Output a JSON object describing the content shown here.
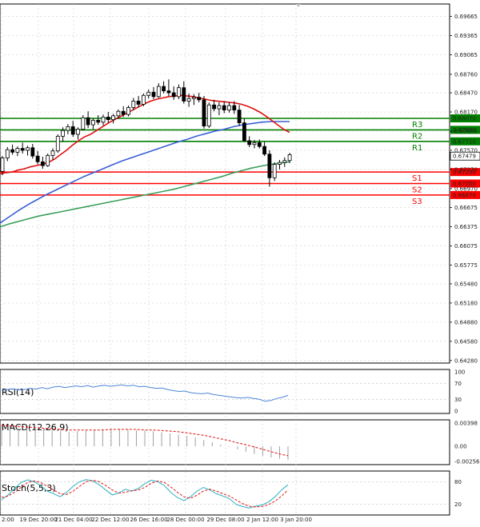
{
  "chart_data": {
    "type": "candlestick",
    "price_axis": {
      "range": [
        0.6424,
        0.6986
      ],
      "ticks": [
        "0.69665",
        "0.69365",
        "0.69065",
        "0.68760",
        "0.68470",
        "0.68170",
        "0.67870",
        "0.67570",
        "0.67270",
        "0.66970",
        "0.66675",
        "0.66375",
        "0.66075",
        "0.65775",
        "0.65480",
        "0.65180",
        "0.64880",
        "0.64580",
        "0.64280"
      ]
    },
    "time_axis": {
      "labels": [
        "2:00",
        "19 Dec 20:00",
        "21 Dec 04:00",
        "22 Dec 12:00",
        "26 Dec 16:00",
        "28 Dec 00:00",
        "29 Dec 08:00",
        "2 Jan 12:00",
        "3 Jan 20:00"
      ]
    },
    "last_price": "0.67479",
    "levels": [
      {
        "name": "R3",
        "value": 0.6807,
        "label": "0.68070",
        "color": "#008000"
      },
      {
        "name": "R2",
        "value": 0.6789,
        "label": "0.67890",
        "color": "#008000"
      },
      {
        "name": "R1",
        "value": 0.6771,
        "label": "0.67710",
        "color": "#008000"
      },
      {
        "name": "S1",
        "value": 0.6723,
        "label": "0.67230",
        "color": "#ff0000"
      },
      {
        "name": "S2",
        "value": 0.6705,
        "label": "0.67050",
        "color": "#ff0000"
      },
      {
        "name": "S3",
        "value": 0.6687,
        "label": "0.66870",
        "color": "#ff0000"
      }
    ],
    "candles": [
      [
        0.6724,
        0.6748,
        0.6718,
        0.6745
      ],
      [
        0.6745,
        0.6762,
        0.674,
        0.6758
      ],
      [
        0.6758,
        0.6766,
        0.675,
        0.6754
      ],
      [
        0.6754,
        0.6763,
        0.6748,
        0.676
      ],
      [
        0.676,
        0.6769,
        0.6752,
        0.6757
      ],
      [
        0.6757,
        0.6764,
        0.6749,
        0.6761
      ],
      [
        0.6761,
        0.6767,
        0.6744,
        0.6748
      ],
      [
        0.6748,
        0.6756,
        0.6735,
        0.6739
      ],
      [
        0.6739,
        0.6747,
        0.6728,
        0.6733
      ],
      [
        0.6733,
        0.6752,
        0.6731,
        0.6749
      ],
      [
        0.6749,
        0.676,
        0.6742,
        0.6756
      ],
      [
        0.6756,
        0.6782,
        0.6753,
        0.6779
      ],
      [
        0.6779,
        0.6793,
        0.677,
        0.6788
      ],
      [
        0.6788,
        0.6798,
        0.6782,
        0.6794
      ],
      [
        0.6794,
        0.6803,
        0.6778,
        0.6782
      ],
      [
        0.6782,
        0.6793,
        0.6774,
        0.679
      ],
      [
        0.679,
        0.6812,
        0.6788,
        0.6808
      ],
      [
        0.6808,
        0.6818,
        0.6792,
        0.6797
      ],
      [
        0.6797,
        0.6807,
        0.679,
        0.6804
      ],
      [
        0.6804,
        0.6812,
        0.6797,
        0.6801
      ],
      [
        0.6801,
        0.6813,
        0.6796,
        0.6809
      ],
      [
        0.6809,
        0.6817,
        0.68,
        0.6805
      ],
      [
        0.6805,
        0.6814,
        0.6799,
        0.6811
      ],
      [
        0.6811,
        0.6821,
        0.6806,
        0.6818
      ],
      [
        0.6818,
        0.6826,
        0.6809,
        0.6813
      ],
      [
        0.6813,
        0.6827,
        0.681,
        0.6824
      ],
      [
        0.6824,
        0.6839,
        0.682,
        0.6834
      ],
      [
        0.6834,
        0.6842,
        0.6824,
        0.6829
      ],
      [
        0.6829,
        0.6846,
        0.6826,
        0.6843
      ],
      [
        0.6843,
        0.6852,
        0.6838,
        0.6848
      ],
      [
        0.6848,
        0.6856,
        0.6837,
        0.6841
      ],
      [
        0.6841,
        0.6862,
        0.6839,
        0.6857
      ],
      [
        0.6857,
        0.6865,
        0.6846,
        0.685
      ],
      [
        0.685,
        0.6868,
        0.6842,
        0.6847
      ],
      [
        0.6847,
        0.6857,
        0.6836,
        0.6841
      ],
      [
        0.6841,
        0.686,
        0.6837,
        0.6855
      ],
      [
        0.6855,
        0.6865,
        0.683,
        0.6834
      ],
      [
        0.6834,
        0.6846,
        0.6825,
        0.6838
      ],
      [
        0.6838,
        0.6845,
        0.6828,
        0.684
      ],
      [
        0.684,
        0.6847,
        0.6832,
        0.6836
      ],
      [
        0.6836,
        0.6842,
        0.6791,
        0.6795
      ],
      [
        0.6795,
        0.6832,
        0.6792,
        0.6828
      ],
      [
        0.6828,
        0.6836,
        0.6818,
        0.6822
      ],
      [
        0.6822,
        0.6832,
        0.6812,
        0.6827
      ],
      [
        0.6827,
        0.6834,
        0.6815,
        0.682
      ],
      [
        0.682,
        0.6832,
        0.6816,
        0.6827
      ],
      [
        0.6827,
        0.6834,
        0.6814,
        0.682
      ],
      [
        0.682,
        0.6828,
        0.6795,
        0.68
      ],
      [
        0.68,
        0.6807,
        0.677,
        0.6772
      ],
      [
        0.6772,
        0.6779,
        0.6762,
        0.6766
      ],
      [
        0.6766,
        0.6773,
        0.676,
        0.6769
      ],
      [
        0.6769,
        0.6774,
        0.676,
        0.6763
      ],
      [
        0.6763,
        0.677,
        0.6748,
        0.6751
      ],
      [
        0.6751,
        0.6757,
        0.67,
        0.6714
      ],
      [
        0.6714,
        0.6738,
        0.6709,
        0.6735
      ],
      [
        0.6735,
        0.6742,
        0.6727,
        0.6738
      ],
      [
        0.6738,
        0.6746,
        0.6731,
        0.6741
      ],
      [
        0.6741,
        0.6753,
        0.6737,
        0.675
      ]
    ],
    "ma_red": [
      0.672,
      0.6722,
      0.6723,
      0.6726,
      0.6728,
      0.6731,
      0.6733,
      0.6735,
      0.6738,
      0.6743,
      0.675,
      0.6757,
      0.6765,
      0.6772,
      0.6778,
      0.6782,
      0.6788,
      0.6794,
      0.68,
      0.6805,
      0.681,
      0.6815,
      0.682,
      0.6825,
      0.683,
      0.6834,
      0.6837,
      0.6839,
      0.6841,
      0.6842,
      0.6843,
      0.6842,
      0.6841,
      0.6839,
      0.6837,
      0.6835,
      0.6834,
      0.6833,
      0.6832,
      0.6831,
      0.6829,
      0.6826,
      0.6822,
      0.6817,
      0.6811,
      0.6804,
      0.6797,
      0.679,
      0.6785
    ],
    "ma_blue": [
      0.6643,
      0.6653,
      0.6663,
      0.6672,
      0.668,
      0.6688,
      0.6695,
      0.6702,
      0.6709,
      0.6716,
      0.6722,
      0.6728,
      0.6734,
      0.674,
      0.6745,
      0.675,
      0.6755,
      0.676,
      0.6765,
      0.677,
      0.6774,
      0.6779,
      0.6783,
      0.6787,
      0.679,
      0.6794,
      0.6797,
      0.6799,
      0.6801,
      0.6802,
      0.6802,
      0.6802
    ],
    "ma_green": [
      0.6637,
      0.6642,
      0.6646,
      0.665,
      0.6654,
      0.6657,
      0.666,
      0.6663,
      0.6666,
      0.6669,
      0.6672,
      0.6675,
      0.6678,
      0.6681,
      0.6684,
      0.6687,
      0.669,
      0.6693,
      0.6696,
      0.67,
      0.6704,
      0.6708,
      0.6712,
      0.6716,
      0.6721,
      0.6725,
      0.6729,
      0.6732,
      0.6735,
      0.6737,
      0.6739
    ],
    "rsi": {
      "label": "RSI(14)",
      "levels": [
        "100",
        "70",
        "30",
        "0"
      ],
      "values": [
        52,
        55,
        57,
        54,
        55,
        58,
        56,
        60,
        57,
        61,
        63,
        60,
        62,
        64,
        62,
        65,
        61,
        64,
        66,
        63,
        65,
        67,
        64,
        66,
        62,
        63,
        60,
        58,
        59,
        55,
        52,
        50,
        51,
        47,
        45,
        44,
        46,
        42,
        40,
        38,
        36,
        34,
        33,
        35,
        32,
        30,
        25,
        27,
        32,
        35,
        40
      ]
    },
    "macd": {
      "label": "MACD(12,26,9)",
      "ticks": [
        "0.00398",
        "0.00",
        "-0.002566"
      ],
      "hist": [
        0.0036,
        0.0034,
        0.0032,
        0.0031,
        0.003,
        0.0029,
        0.0027,
        0.0026,
        0.0025,
        0.0026,
        0.0027,
        0.0028,
        0.0029,
        0.003,
        0.003,
        0.0029,
        0.0028,
        0.0027,
        0.0026,
        0.0024,
        0.0022,
        0.002,
        0.0018,
        0.0015,
        0.0011,
        0.0007,
        0.0003,
        -0.0001,
        -0.0005,
        -0.0009,
        -0.0013,
        -0.0016,
        -0.0019,
        -0.0021,
        -0.0023
      ],
      "signal": [
        0.0036,
        0.0035,
        0.0034,
        0.0033,
        0.0032,
        0.0031,
        0.003,
        0.0029,
        0.0028,
        0.0028,
        0.0028,
        0.0028,
        0.0028,
        0.0029,
        0.0029,
        0.0029,
        0.0029,
        0.0028,
        0.0028,
        0.0027,
        0.0026,
        0.0025,
        0.0023,
        0.0021,
        0.0019,
        0.0016,
        0.0013,
        0.001,
        0.0006,
        0.0003,
        -0.0001,
        -0.0005,
        -0.0009,
        -0.0013,
        -0.0016
      ]
    },
    "stoch": {
      "label": "Stoch(5,5,3)",
      "ticks": [
        "80",
        "20"
      ],
      "k": [
        32,
        45,
        62,
        78,
        85,
        80,
        70,
        55,
        48,
        40,
        52,
        68,
        80,
        86,
        82,
        72,
        58,
        45,
        50,
        60,
        55,
        62,
        75,
        84,
        80,
        70,
        52,
        38,
        30,
        40,
        55,
        65,
        58,
        48,
        42,
        35,
        20,
        14,
        10,
        15,
        18,
        26,
        40,
        58,
        72
      ],
      "d": [
        38,
        42,
        52,
        65,
        78,
        82,
        78,
        68,
        58,
        48,
        46,
        55,
        68,
        80,
        84,
        80,
        70,
        58,
        50,
        52,
        56,
        58,
        65,
        76,
        82,
        78,
        66,
        52,
        40,
        36,
        44,
        55,
        60,
        55,
        48,
        42,
        32,
        22,
        15,
        13,
        14,
        19,
        28,
        42,
        58
      ]
    }
  }
}
